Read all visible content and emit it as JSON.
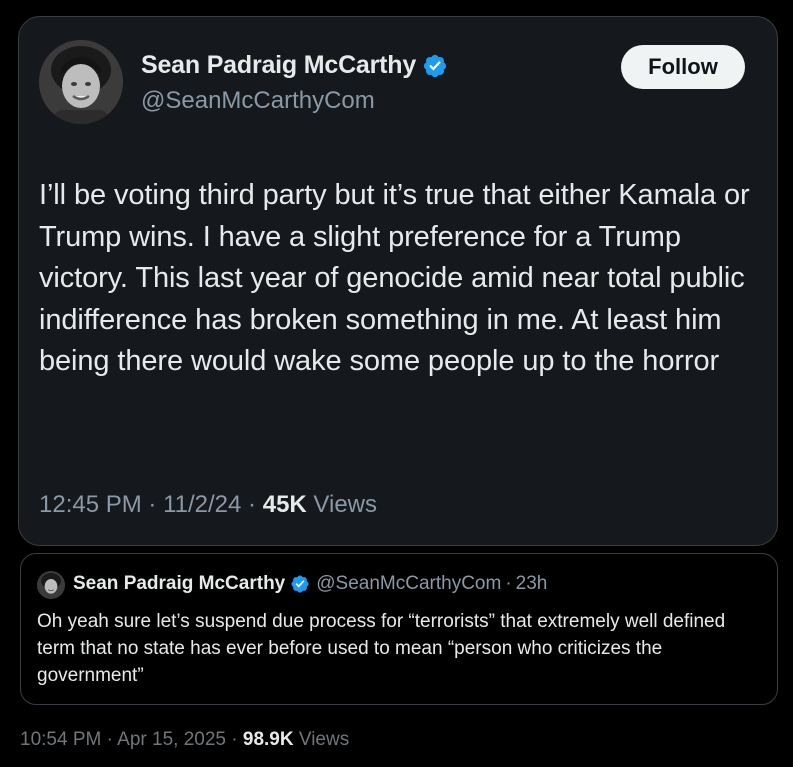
{
  "main_tweet": {
    "display_name": "Sean Padraig McCarthy",
    "handle": "@SeanMcCarthyCom",
    "follow_label": "Follow",
    "text": "I’ll be voting third party but it’s true that either Kamala or Trump wins. I have a slight preference for a Trump victory. This last year of genocide amid near total public indifference has broken something in me. At least him being there would wake some people up to the horror",
    "time": "12:45 PM",
    "date": "11/2/24",
    "views_count": "45K",
    "views_label": "Views",
    "verified_icon": "verified-badge-icon",
    "accent_color": "#1d9bf0"
  },
  "quote_tweet": {
    "display_name": "Sean Padraig McCarthy",
    "handle": "@SeanMcCarthyCom",
    "age": "23h",
    "text": "Oh yeah sure let’s suspend due process for “terrorists” that extremely well defined term that no state has ever before used to mean “person who criticizes the government”"
  },
  "footer": {
    "time": "10:54 PM",
    "date": "Apr 15, 2025",
    "views_count": "98.9K",
    "views_label": "Views"
  },
  "separator": "·"
}
